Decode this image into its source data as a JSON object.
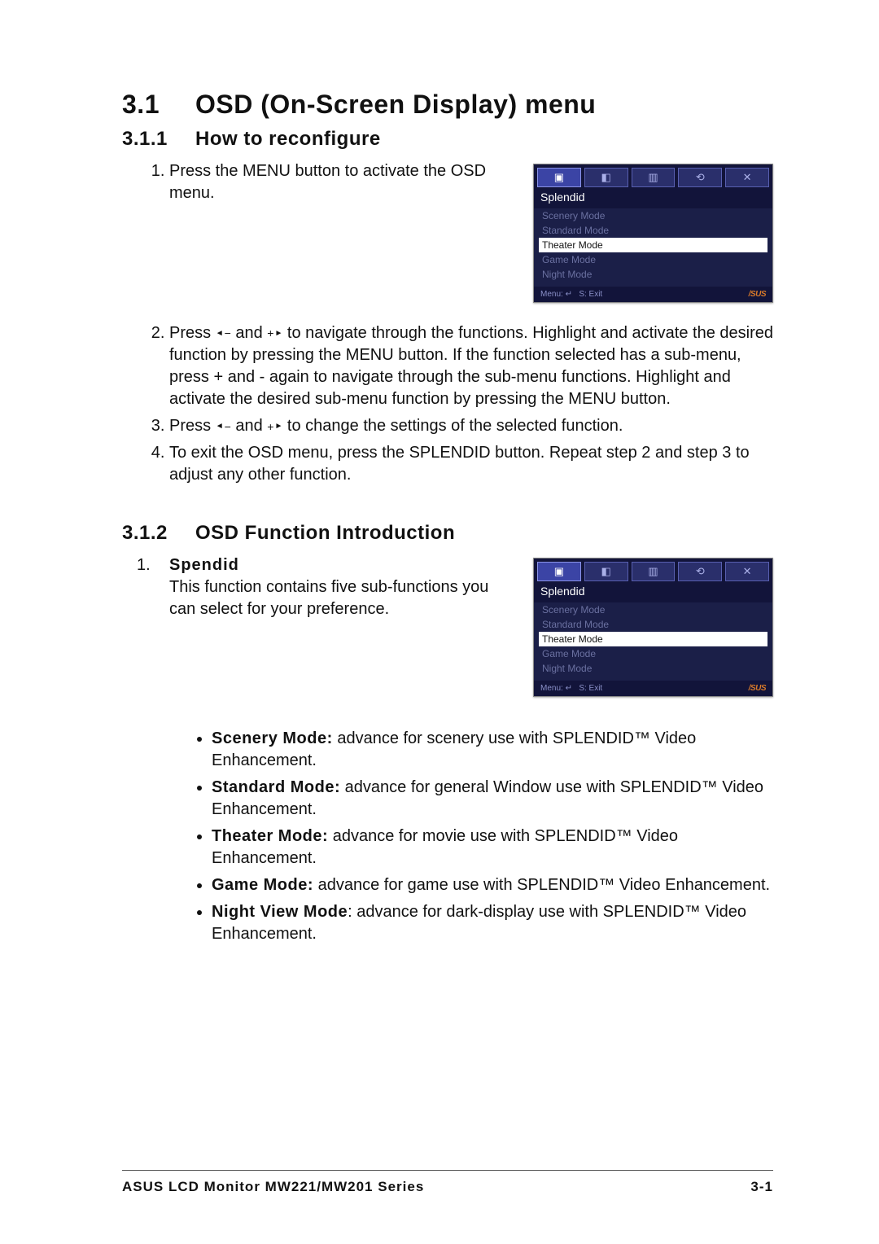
{
  "section": {
    "num": "3.1",
    "title": "OSD (On-Screen Display) menu"
  },
  "sub1": {
    "num": "3.1.1",
    "title": "How to reconfigure"
  },
  "sub2": {
    "num": "3.1.2",
    "title": "OSD Function Introduction"
  },
  "steps": {
    "s1": "Press the MENU button to activate the OSD menu.",
    "s2a": "Press ",
    "s2b": " and ",
    "s2c": " to navigate through the functions. Highlight and activate the desired function by pressing the MENU button. If the function selected has a sub-menu, press + and - again to navigate through the sub-menu functions. Highlight and activate the desired sub-menu function by pressing the MENU button.",
    "s3a": "Press ",
    "s3b": " and ",
    "s3c": " to change the settings of the selected function.",
    "s4": "To exit the OSD menu, press the SPLENDID button. Repeat step 2 and step 3 to adjust any other function."
  },
  "splendid_block": {
    "num": "1.",
    "label": "Spendid",
    "desc": "This function contains five sub-functions you can select for your preference."
  },
  "modes": {
    "scenery": {
      "label": "Scenery Mode:",
      "desc": " advance for scenery use with SPLENDID™ Video Enhancement."
    },
    "standard": {
      "label": "Standard Mode:",
      "desc": " advance for general Window use with SPLENDID™ Video Enhancement."
    },
    "theater": {
      "label": "Theater Mode:",
      "desc": " advance for movie use with SPLENDID™ Video Enhancement."
    },
    "game": {
      "label": "Game Mode:",
      "desc": " advance for game use with SPLENDID™ Video Enhancement."
    },
    "night": {
      "label": "Night View Mode",
      "desc": ": advance for dark-display use with SPLENDID™ Video Enhancement."
    }
  },
  "osd": {
    "title": "Splendid",
    "items": {
      "scenery": "Scenery Mode",
      "standard": "Standard Mode",
      "theater": "Theater Mode",
      "game": "Game Mode",
      "night": "Night Mode"
    },
    "footer_menu": "Menu:",
    "footer_s": "S: Exit",
    "brand": "/SUS",
    "tabicons": {
      "t1": "▣",
      "t2": "◧",
      "t3": "▥",
      "t4": "⟲",
      "t5": "✕"
    }
  },
  "footer": {
    "left": "ASUS LCD Monitor MW221/MW201 Series",
    "right": "3-1"
  }
}
